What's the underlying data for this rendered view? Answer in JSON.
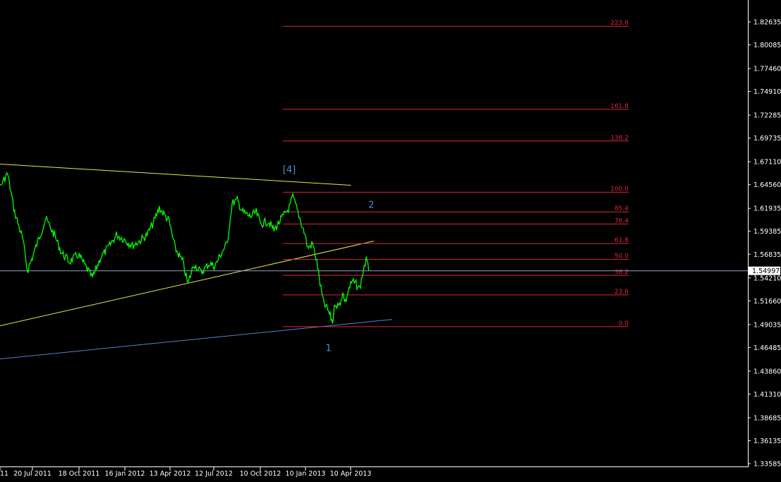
{
  "chart_data": {
    "type": "line",
    "title": "",
    "xlabel": "",
    "ylabel": "",
    "grid": false,
    "colors": {
      "background": "#000000",
      "price": "#00ff00",
      "axis": "#ffffff",
      "fibonacci": "#e0243a",
      "trendline": "#e8e84a",
      "support": "#5a7fd0",
      "current_price_line": "#8fa6c8",
      "current_price_box": "#ffffff",
      "wave_labels": "#4f8fd0"
    },
    "ylim": [
      1.33585,
      1.8515
    ],
    "y_ticks": [
      "1.82635",
      "1.80085",
      "1.77460",
      "1.74910",
      "1.72285",
      "1.69735",
      "1.67110",
      "1.64560",
      "1.61935",
      "1.59385",
      "1.56835",
      "1.54210",
      "1.51660",
      "1.49035",
      "1.46485",
      "1.43860",
      "1.41310",
      "1.38685",
      "1.36135",
      "1.33585"
    ],
    "x_ticks": [
      "11",
      "20 Jul 2011",
      "18 Oct 2011",
      "16 Jan 2012",
      "13 Apr 2012",
      "12 Jul 2012",
      "10 Oct 2012",
      "10 Jan 2013",
      "10 Apr 2013"
    ],
    "current_price": "1.54997",
    "fibonacci": {
      "levels": [
        {
          "label": "223.6",
          "price": 1.8215
        },
        {
          "label": "161.8",
          "price": 1.7293
        },
        {
          "label": "138.2",
          "price": 1.6941
        },
        {
          "label": "100.0",
          "price": 1.6372
        },
        {
          "label": "85.4",
          "price": 1.6154
        },
        {
          "label": "76.4",
          "price": 1.602
        },
        {
          "label": "61.8",
          "price": 1.5802
        },
        {
          "label": "50.0",
          "price": 1.5626
        },
        {
          "label": "38.2",
          "price": 1.545
        },
        {
          "label": "23.6",
          "price": 1.5232
        },
        {
          "label": "0.0",
          "price": 1.488
        }
      ]
    },
    "wave_labels": [
      {
        "text": "[4]",
        "date": "2012-12-05",
        "price": 1.659
      },
      {
        "text": "2",
        "date": "2013-05-15",
        "price": 1.62
      },
      {
        "text": "1",
        "date": "2013-02-20",
        "price": 1.461
      }
    ],
    "trendlines": [
      {
        "name": "upper-resistance",
        "color": "trendline",
        "p1": {
          "date": "2011-04-01",
          "price": 1.67
        },
        "p2": {
          "date": "2013-04-05",
          "price": 1.645
        }
      },
      {
        "name": "lower-trendline",
        "color": "trendline",
        "p1": {
          "date": "2011-04-01",
          "price": 1.483
        },
        "p2": {
          "date": "2013-05-20",
          "price": 1.583
        }
      },
      {
        "name": "support-line",
        "color": "support",
        "p1": {
          "date": "2011-04-01",
          "price": 1.4495
        },
        "p2": {
          "date": "2013-06-25",
          "price": 1.496
        }
      }
    ],
    "series": [
      {
        "values": [
          {
            "date": "2011-04-01",
            "price": 1.619
          },
          {
            "date": "2011-04-15",
            "price": 1.602
          },
          {
            "date": "2011-05-01",
            "price": 1.633
          },
          {
            "date": "2011-05-15",
            "price": 1.641
          },
          {
            "date": "2011-06-01",
            "price": 1.658
          },
          {
            "date": "2011-06-15",
            "price": 1.615
          },
          {
            "date": "2011-07-01",
            "price": 1.585
          },
          {
            "date": "2011-07-10",
            "price": 1.55
          },
          {
            "date": "2011-07-20",
            "price": 1.565
          },
          {
            "date": "2011-08-01",
            "price": 1.585
          },
          {
            "date": "2011-08-15",
            "price": 1.608
          },
          {
            "date": "2011-09-01",
            "price": 1.59
          },
          {
            "date": "2011-09-15",
            "price": 1.57
          },
          {
            "date": "2011-10-01",
            "price": 1.56
          },
          {
            "date": "2011-10-18",
            "price": 1.568
          },
          {
            "date": "2011-11-01",
            "price": 1.555
          },
          {
            "date": "2011-11-15",
            "price": 1.542
          },
          {
            "date": "2011-12-01",
            "price": 1.565
          },
          {
            "date": "2011-12-15",
            "price": 1.575
          },
          {
            "date": "2012-01-01",
            "price": 1.59
          },
          {
            "date": "2012-01-16",
            "price": 1.585
          },
          {
            "date": "2012-02-01",
            "price": 1.578
          },
          {
            "date": "2012-02-15",
            "price": 1.583
          },
          {
            "date": "2012-03-01",
            "price": 1.59
          },
          {
            "date": "2012-03-15",
            "price": 1.605
          },
          {
            "date": "2012-03-25",
            "price": 1.62
          },
          {
            "date": "2012-04-13",
            "price": 1.605
          },
          {
            "date": "2012-04-25",
            "price": 1.575
          },
          {
            "date": "2012-05-10",
            "price": 1.56
          },
          {
            "date": "2012-05-20",
            "price": 1.535
          },
          {
            "date": "2012-06-01",
            "price": 1.558
          },
          {
            "date": "2012-06-15",
            "price": 1.548
          },
          {
            "date": "2012-07-01",
            "price": 1.558
          },
          {
            "date": "2012-07-12",
            "price": 1.555
          },
          {
            "date": "2012-07-25",
            "price": 1.57
          },
          {
            "date": "2012-08-05",
            "price": 1.58
          },
          {
            "date": "2012-08-15",
            "price": 1.625
          },
          {
            "date": "2012-08-25",
            "price": 1.628
          },
          {
            "date": "2012-09-05",
            "price": 1.615
          },
          {
            "date": "2012-09-20",
            "price": 1.61
          },
          {
            "date": "2012-10-01",
            "price": 1.615
          },
          {
            "date": "2012-10-10",
            "price": 1.602
          },
          {
            "date": "2012-10-25",
            "price": 1.605
          },
          {
            "date": "2012-11-05",
            "price": 1.595
          },
          {
            "date": "2012-11-20",
            "price": 1.608
          },
          {
            "date": "2012-12-05",
            "price": 1.62
          },
          {
            "date": "2012-12-12",
            "price": 1.632
          },
          {
            "date": "2012-12-22",
            "price": 1.615
          },
          {
            "date": "2013-01-05",
            "price": 1.59
          },
          {
            "date": "2013-01-10",
            "price": 1.575
          },
          {
            "date": "2013-01-20",
            "price": 1.58
          },
          {
            "date": "2013-01-28",
            "price": 1.56
          },
          {
            "date": "2013-02-05",
            "price": 1.53
          },
          {
            "date": "2013-02-10",
            "price": 1.515
          },
          {
            "date": "2013-02-20",
            "price": 1.505
          },
          {
            "date": "2013-02-28",
            "price": 1.493
          },
          {
            "date": "2013-03-05",
            "price": 1.515
          },
          {
            "date": "2013-03-12",
            "price": 1.51
          },
          {
            "date": "2013-03-20",
            "price": 1.525
          },
          {
            "date": "2013-03-25",
            "price": 1.515
          },
          {
            "date": "2013-04-01",
            "price": 1.53
          },
          {
            "date": "2013-04-08",
            "price": 1.538
          },
          {
            "date": "2013-04-15",
            "price": 1.535
          },
          {
            "date": "2013-04-22",
            "price": 1.53
          },
          {
            "date": "2013-05-01",
            "price": 1.555
          },
          {
            "date": "2013-05-05",
            "price": 1.562
          },
          {
            "date": "2013-05-10",
            "price": 1.55
          }
        ]
      }
    ]
  }
}
